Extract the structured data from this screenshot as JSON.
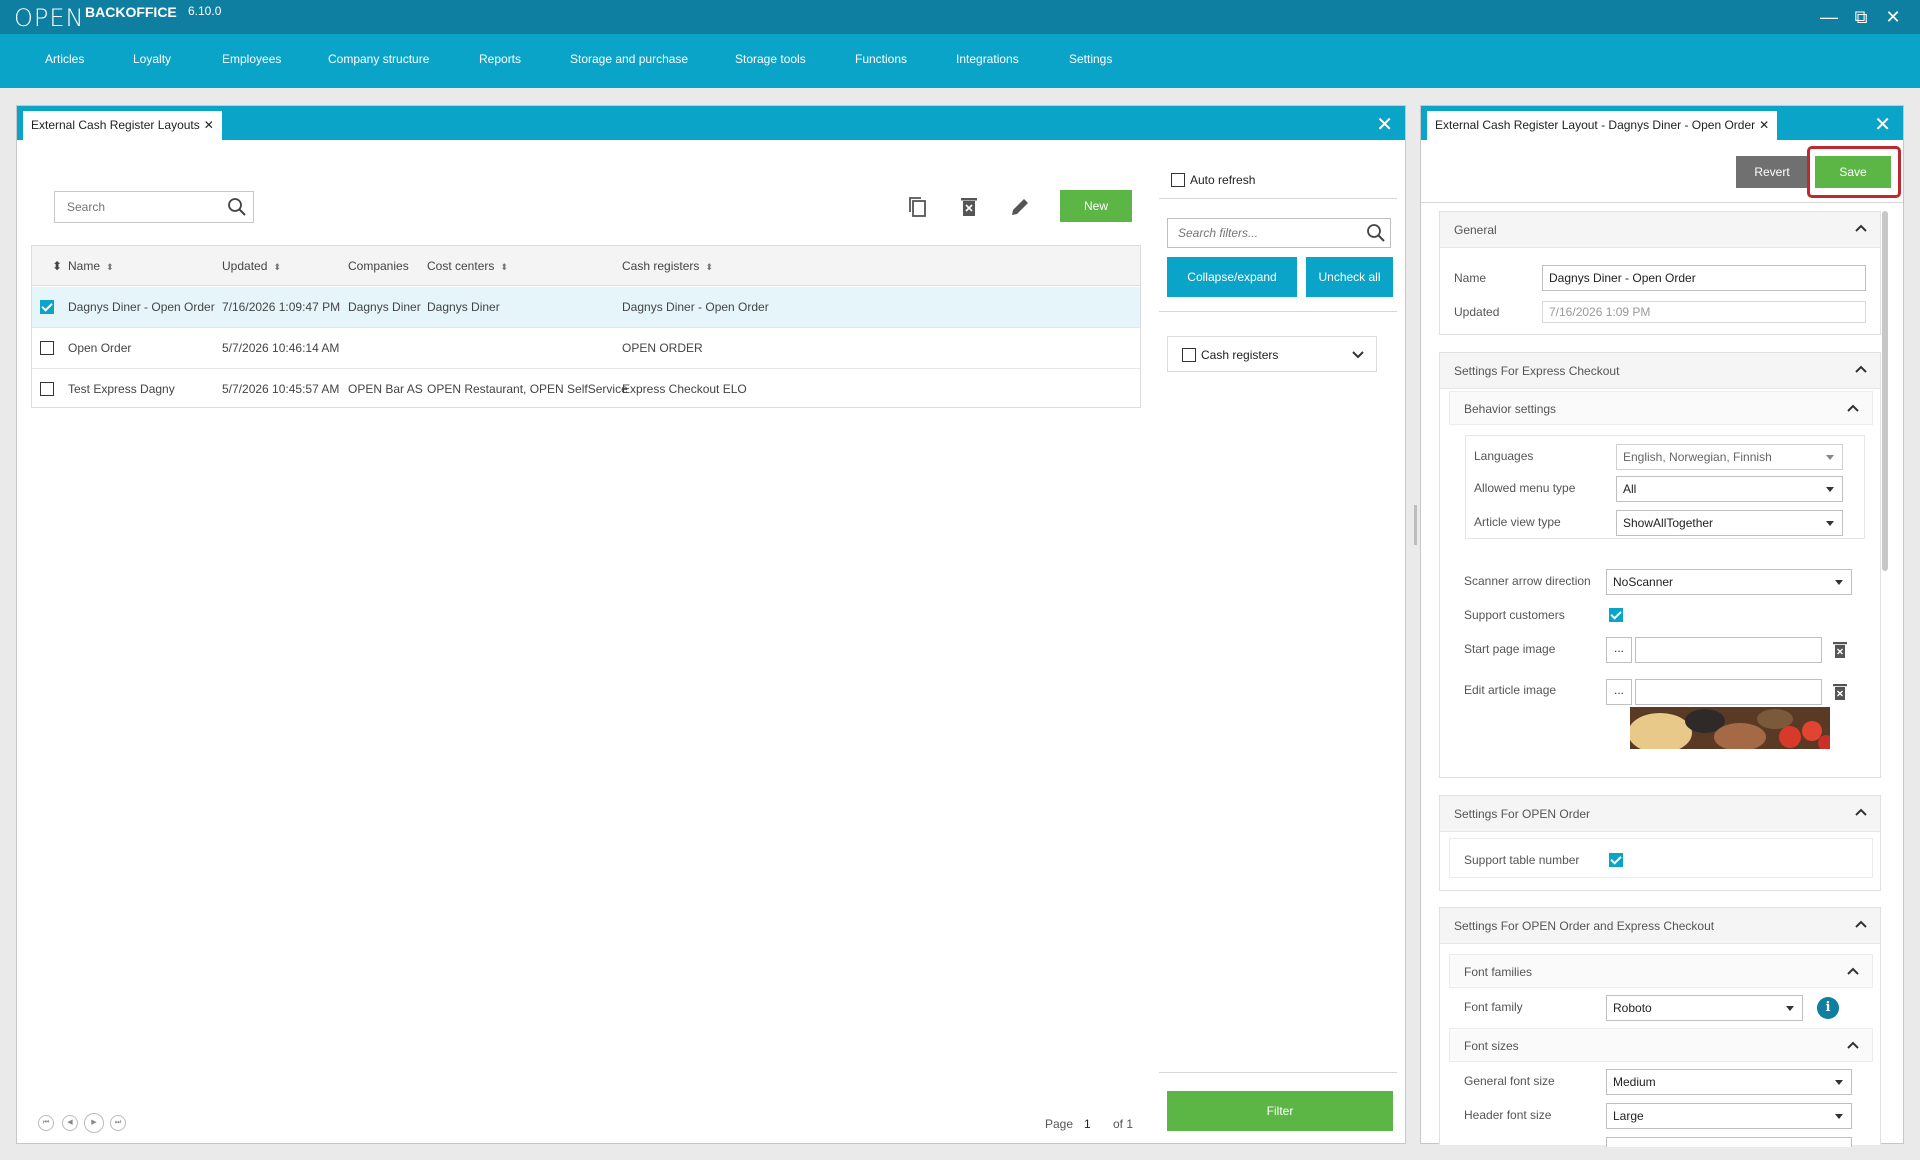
{
  "app": {
    "logo": "OPEN",
    "name": "BACKOFFICE",
    "version": "6.10.0"
  },
  "window_controls": {
    "minimize": "—",
    "restore": "⧉",
    "close": "✕"
  },
  "nav": [
    "Articles",
    "Loyalty",
    "Employees",
    "Company structure",
    "Reports",
    "Storage and purchase",
    "Storage tools",
    "Functions",
    "Integrations",
    "Settings"
  ],
  "left_panel": {
    "tab_title": "External Cash Register Layouts",
    "search_placeholder": "Search",
    "new_button": "New",
    "columns": [
      "Name",
      "Updated",
      "Companies",
      "Cost centers",
      "Cash registers"
    ],
    "rows": [
      {
        "checked": true,
        "name": "Dagnys Diner - Open Order",
        "updated": "7/16/2026 1:09:47 PM",
        "companies": "Dagnys Diner",
        "cost_centers": "Dagnys Diner",
        "cash_registers": "Dagnys Diner - Open Order"
      },
      {
        "checked": false,
        "name": "Open Order",
        "updated": "5/7/2026 10:46:14 AM",
        "companies": "",
        "cost_centers": "",
        "cash_registers": "OPEN ORDER"
      },
      {
        "checked": false,
        "name": "Test Express Dagny",
        "updated": "5/7/2026 10:45:57 AM",
        "companies": "OPEN Bar AS",
        "cost_centers": "OPEN Restaurant, OPEN SelfService",
        "cash_registers": "Express Checkout ELO"
      }
    ],
    "pager": {
      "page_label": "Page",
      "page": "1",
      "of_label": "of 1"
    },
    "filters": {
      "auto_refresh": "Auto refresh",
      "search_placeholder": "Search filters...",
      "collapse_expand": "Collapse/expand",
      "uncheck_all": "Uncheck all",
      "cash_registers": "Cash registers",
      "filter_button": "Filter"
    }
  },
  "right_panel": {
    "tab_title": "External Cash Register Layout - Dagnys Diner - Open Order",
    "revert": "Revert",
    "save": "Save",
    "general": {
      "title": "General",
      "name_label": "Name",
      "name_value": "Dagnys Diner - Open Order",
      "updated_label": "Updated",
      "updated_value": "7/16/2026 1:09 PM"
    },
    "express": {
      "title": "Settings For Express Checkout",
      "behavior_title": "Behavior settings",
      "languages_label": "Languages",
      "languages_value": "English, Norwegian, Finnish",
      "allowed_menu_label": "Allowed menu type",
      "allowed_menu_value": "All",
      "article_view_label": "Article view type",
      "article_view_value": "ShowAllTogether",
      "scanner_label": "Scanner arrow direction",
      "scanner_value": "NoScanner",
      "support_customers_label": "Support customers",
      "start_image_label": "Start page image",
      "edit_image_label": "Edit article image",
      "ellipsis": "..."
    },
    "open_order": {
      "title": "Settings For OPEN Order",
      "support_table_label": "Support table number"
    },
    "both": {
      "title": "Settings For OPEN Order and Express Checkout",
      "font_families_title": "Font families",
      "font_family_label": "Font family",
      "font_family_value": "Roboto",
      "font_sizes_title": "Font sizes",
      "general_size_label": "General font size",
      "general_size_value": "Medium",
      "header_size_label": "Header font size",
      "header_size_value": "Large"
    }
  },
  "colors": {
    "titlebar": "#0e7fa0",
    "nav": "#0aa4c8",
    "green": "#5cb646",
    "highlight": "#c0282d"
  }
}
